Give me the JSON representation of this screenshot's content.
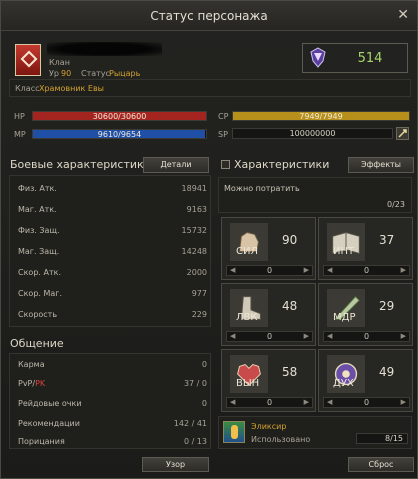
{
  "window": {
    "title": "Статус персонажа",
    "close_glyph": "✕"
  },
  "character": {
    "clan_label": "Клан",
    "level_label": "Ур",
    "level_value": "90",
    "status_label": "Статус",
    "status_value": "Рыцарь",
    "class_label": "Класс",
    "class_value": "Храмовник Евы",
    "rank_value": "514"
  },
  "vitals": {
    "hp": {
      "label": "HP",
      "text": "30600/30600",
      "fraction": 1.0,
      "color": "#a4241f"
    },
    "mp": {
      "label": "MP",
      "text": "9610/9654",
      "fraction": 0.995,
      "color": "#1f4fa6"
    },
    "cp": {
      "label": "CP",
      "text": "7949/7949",
      "fraction": 1.0,
      "color": "#b7901c"
    },
    "sp": {
      "label": "SP",
      "text": "100000000"
    }
  },
  "combat": {
    "title": "Боевые характеристики",
    "details_button": "Детали",
    "rows": [
      {
        "label": "Физ. Атк.",
        "value": "18941"
      },
      {
        "label": "Маг. Атк.",
        "value": "9163"
      },
      {
        "label": "Физ. Защ.",
        "value": "15732"
      },
      {
        "label": "Маг. Защ.",
        "value": "14248"
      },
      {
        "label": "Скор. Атк.",
        "value": "2000"
      },
      {
        "label": "Скор. Маг.",
        "value": "977"
      },
      {
        "label": "Скорость",
        "value": "229"
      }
    ]
  },
  "social": {
    "title": "Общение",
    "karma_label": "Карма",
    "karma_value": "0",
    "pvp_label": "PvP/",
    "pk_label": "PK",
    "pvp_value": "37 / 0",
    "raid_label": "Рейдовые очки",
    "raid_value": "0",
    "recommend_label": "Рекомендации",
    "recommend_value": "142 / 41",
    "censure_label": "Порицания",
    "censure_value": "0 / 13"
  },
  "characteristics": {
    "title": "Характеристики",
    "effects_button": "Эффекты",
    "spend_label": "Можно потратить",
    "spend_value": "0/23",
    "stats": [
      {
        "abbr": "СИЛ",
        "value": "90",
        "allocated": "0",
        "icon": "fist-icon"
      },
      {
        "abbr": "ИНТ",
        "value": "37",
        "allocated": "0",
        "icon": "book-icon"
      },
      {
        "abbr": "ЛВК",
        "value": "48",
        "allocated": "0",
        "icon": "boot-icon"
      },
      {
        "abbr": "МДР",
        "value": "29",
        "allocated": "0",
        "icon": "feather-icon"
      },
      {
        "abbr": "ВЫН",
        "value": "58",
        "allocated": "0",
        "icon": "heart-icon"
      },
      {
        "abbr": "ДУХ",
        "value": "49",
        "allocated": "0",
        "icon": "spirit-icon"
      }
    ],
    "arrow_left": "◀",
    "arrow_right": "▶"
  },
  "elixir": {
    "title": "Эликсир",
    "used_label": "Использовано",
    "count": "8/15"
  },
  "footer": {
    "pattern_button": "Узор",
    "reset_button": "Сброс"
  }
}
